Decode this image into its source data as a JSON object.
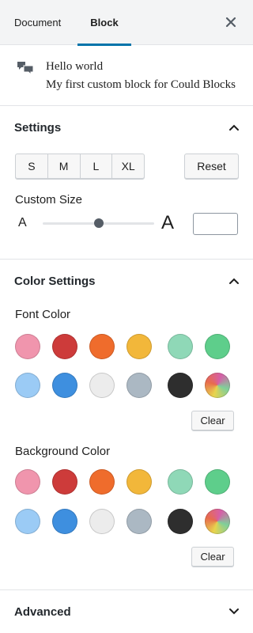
{
  "tabs": {
    "document": "Document",
    "block": "Block"
  },
  "block": {
    "title": "Hello world",
    "description": "My first custom block for Could Blocks",
    "icon": "comments-icon"
  },
  "settings": {
    "title": "Settings",
    "sizes": [
      "S",
      "M",
      "L",
      "XL"
    ],
    "reset_label": "Reset",
    "custom_size_label": "Custom Size",
    "small_a": "A",
    "large_a": "A",
    "custom_size_value": "",
    "slider_fraction": 0.5
  },
  "color_settings": {
    "title": "Color Settings",
    "font_color_label": "Font Color",
    "background_color_label": "Background Color",
    "clear_label": "Clear",
    "palette": [
      "#f095ad",
      "#cd3b3a",
      "#ef6c2c",
      "#f2b73a",
      "#8fd8b7",
      "#5ece8b",
      "#9bcbf5",
      "#3e8fdf",
      "#ececec",
      "#abb8c3",
      "#2e2e2e",
      "gradient"
    ]
  },
  "advanced": {
    "title": "Advanced"
  },
  "colors": {
    "accent": "#0073aa",
    "border": "#e2e4e7"
  }
}
